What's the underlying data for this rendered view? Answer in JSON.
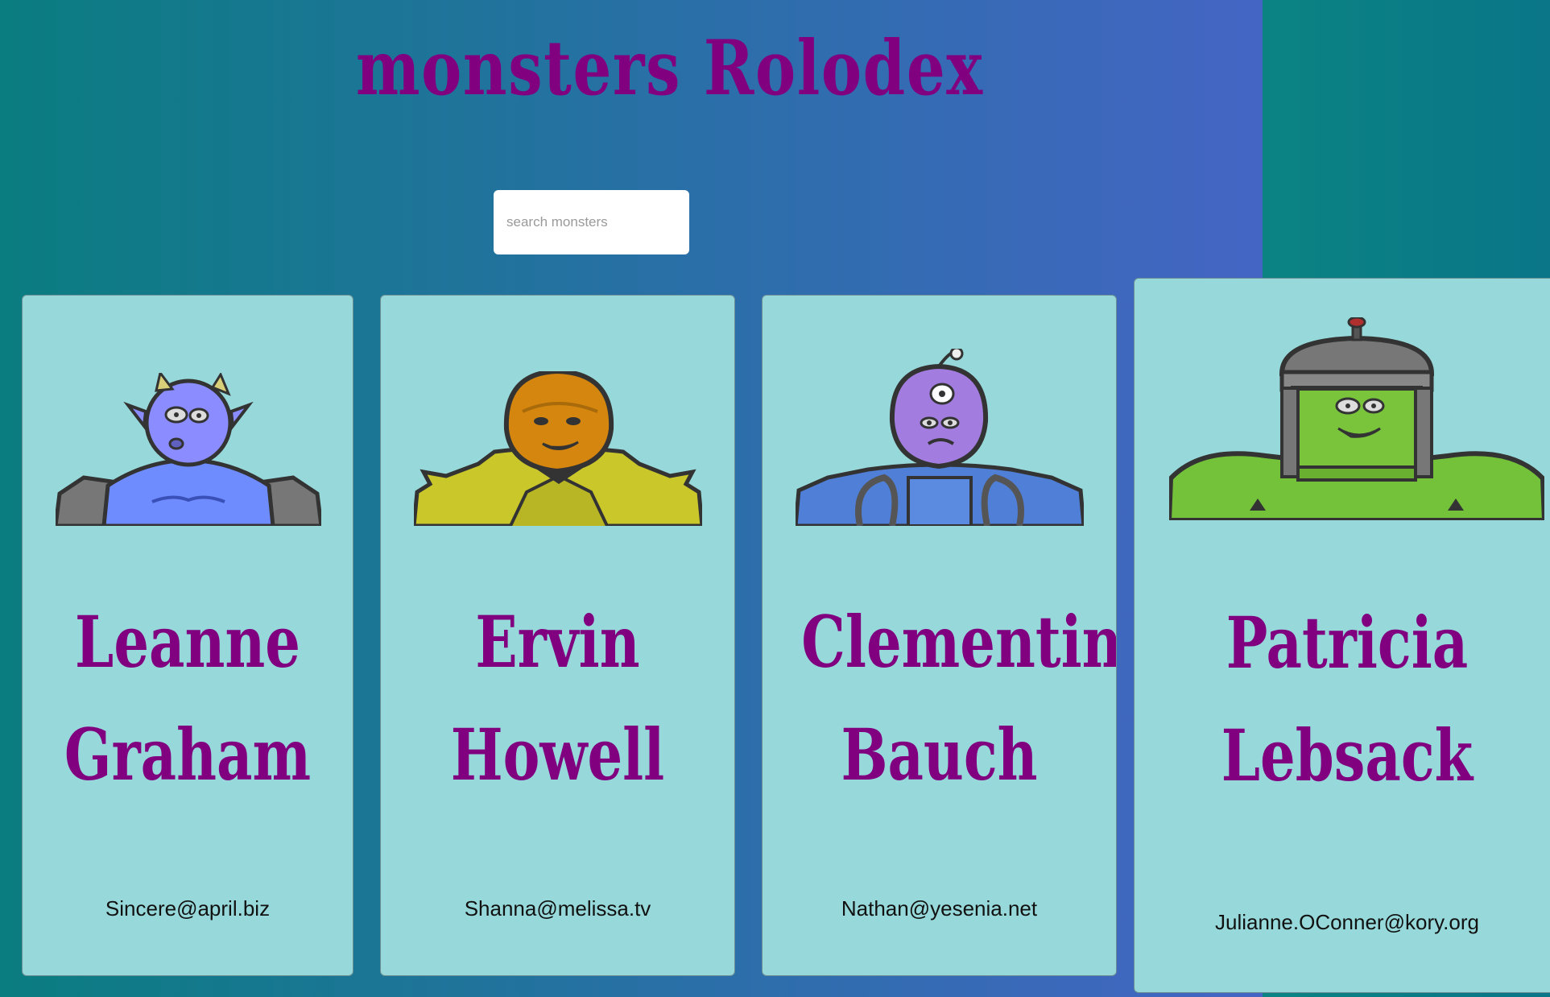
{
  "app": {
    "title": "monsters Rolodex"
  },
  "search": {
    "placeholder": "search monsters",
    "value": ""
  },
  "monsters": [
    {
      "name_line1": "Leanne",
      "name_line2": "Graham",
      "email": "Sincere@april.biz",
      "portrait": "blue-horned-monster-icon"
    },
    {
      "name_line1": "Ervin",
      "name_line2": "Howell",
      "email": "Shanna@melissa.tv",
      "portrait": "orange-spiky-monster-icon"
    },
    {
      "name_line1": "Clementine",
      "name_line2": "Bauch",
      "email": "Nathan@yesenia.net",
      "portrait": "purple-cyclops-monster-icon"
    },
    {
      "name_line1": "Patricia",
      "name_line2": "Lebsack",
      "email": "Julianne.OConner@kory.org",
      "portrait": "green-robot-helmet-monster-icon"
    }
  ],
  "colors": {
    "title": "#800080",
    "card_background": "#97d9da",
    "background_start": "#0a7d80",
    "background_end": "#4465c4"
  }
}
